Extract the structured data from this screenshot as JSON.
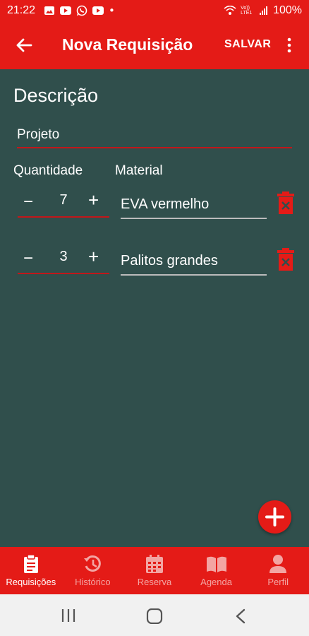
{
  "status_bar": {
    "time": "21:22",
    "notification_icons": [
      "image-icon",
      "youtube-icon",
      "whatsapp-icon",
      "youtube-icon"
    ],
    "dot": "•",
    "battery": "100%",
    "network_label": "Vo)) LTE1"
  },
  "app_bar": {
    "title": "Nova Requisição",
    "save_label": "SALVAR"
  },
  "form": {
    "description_label": "Descrição",
    "project_value": "Projeto",
    "quantity_header": "Quantidade",
    "material_header": "Material",
    "items": [
      {
        "minus": "−",
        "quantity": "7",
        "plus": "+",
        "material": "EVA vermelho"
      },
      {
        "minus": "−",
        "quantity": "3",
        "plus": "+",
        "material": "Palitos grandes"
      }
    ]
  },
  "bottom_nav": {
    "items": [
      {
        "label": "Requisições",
        "icon": "clipboard-icon",
        "active": true
      },
      {
        "label": "Histórico",
        "icon": "history-icon",
        "active": false
      },
      {
        "label": "Reserva",
        "icon": "calendar-icon",
        "active": false
      },
      {
        "label": "Agenda",
        "icon": "book-icon",
        "active": false
      },
      {
        "label": "Perfil",
        "icon": "person-icon",
        "active": false
      }
    ]
  },
  "colors": {
    "primary": "#e41b17",
    "background": "#304f4c",
    "underline": "#c2171a"
  }
}
